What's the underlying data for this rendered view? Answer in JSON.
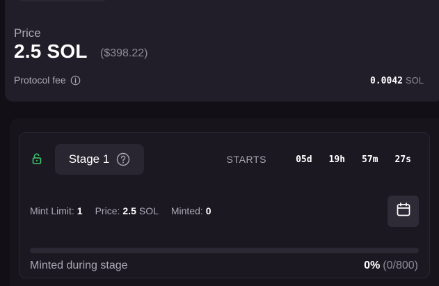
{
  "price": {
    "label": "Price",
    "value": "2.5 SOL",
    "usd": "($398.22)",
    "fee_label": "Protocol fee",
    "fee_value": "0.0042",
    "fee_unit": "SOL"
  },
  "stage": {
    "name": "Stage 1",
    "starts_label": "STARTS",
    "countdown": {
      "days": "05d",
      "hours": "19h",
      "minutes": "57m",
      "seconds": "27s"
    },
    "mint_limit_label": "Mint Limit:",
    "mint_limit_value": "1",
    "price_label": "Price:",
    "price_value": "2.5",
    "price_unit": "SOL",
    "minted_label": "Minted:",
    "minted_value": "0",
    "progress_label": "Minted during stage",
    "progress_percent": "0%",
    "progress_count": "(0/800)",
    "progress_fraction": 0
  },
  "icons": {
    "info": "info-circle-icon",
    "lock": "unlocked-lock-icon",
    "help": "question-circle-icon",
    "calendar": "calendar-icon"
  },
  "colors": {
    "accent_green": "#3ec86a",
    "card_bg": "#221e29",
    "page_bg": "#121016"
  }
}
